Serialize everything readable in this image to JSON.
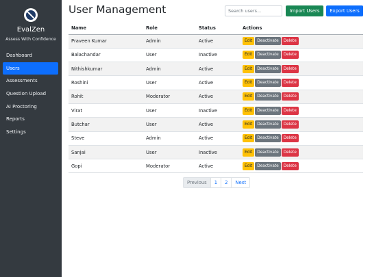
{
  "brand": {
    "name": "EvalZen",
    "tagline": "Assess With Confidence",
    "logo_icon": "brain-logo-icon"
  },
  "sidebar": {
    "items": [
      {
        "label": "Dashboard",
        "active": false
      },
      {
        "label": "Users",
        "active": true
      },
      {
        "label": "Assessments",
        "active": false
      },
      {
        "label": "Question Upload",
        "active": false
      },
      {
        "label": "AI Proctoring",
        "active": false
      },
      {
        "label": "Reports",
        "active": false
      },
      {
        "label": "Settings",
        "active": false
      }
    ]
  },
  "header": {
    "title": "User Management",
    "search_placeholder": "Search users...",
    "import_label": "Import Users",
    "export_label": "Export Users"
  },
  "table": {
    "columns": [
      "Name",
      "Role",
      "Status",
      "Actions"
    ],
    "actions": {
      "edit": "Edit",
      "deactivate": "Deactivate",
      "delete": "Delete"
    },
    "rows": [
      {
        "name": "Praveen Kumar",
        "role": "Admin",
        "status": "Active"
      },
      {
        "name": "Balachandar",
        "role": "User",
        "status": "Inactive"
      },
      {
        "name": "Nithishkumar",
        "role": "Admin",
        "status": "Active"
      },
      {
        "name": "Roshini",
        "role": "User",
        "status": "Active"
      },
      {
        "name": "Rohit",
        "role": "Moderator",
        "status": "Active"
      },
      {
        "name": "Virat",
        "role": "User",
        "status": "Inactive"
      },
      {
        "name": "Butchar",
        "role": "User",
        "status": "Active"
      },
      {
        "name": "Steve",
        "role": "Admin",
        "status": "Active"
      },
      {
        "name": "Sanjai",
        "role": "User",
        "status": "Inactive"
      },
      {
        "name": "Gopi",
        "role": "Moderator",
        "status": "Active"
      }
    ]
  },
  "pagination": {
    "previous": "Previous",
    "pages": [
      "1",
      "2"
    ],
    "next": "Next"
  },
  "colors": {
    "sidebar_bg": "#343a40",
    "primary": "#0d6efd",
    "success": "#198754",
    "warning": "#ffc107",
    "secondary": "#6c757d",
    "danger": "#dc3545"
  }
}
